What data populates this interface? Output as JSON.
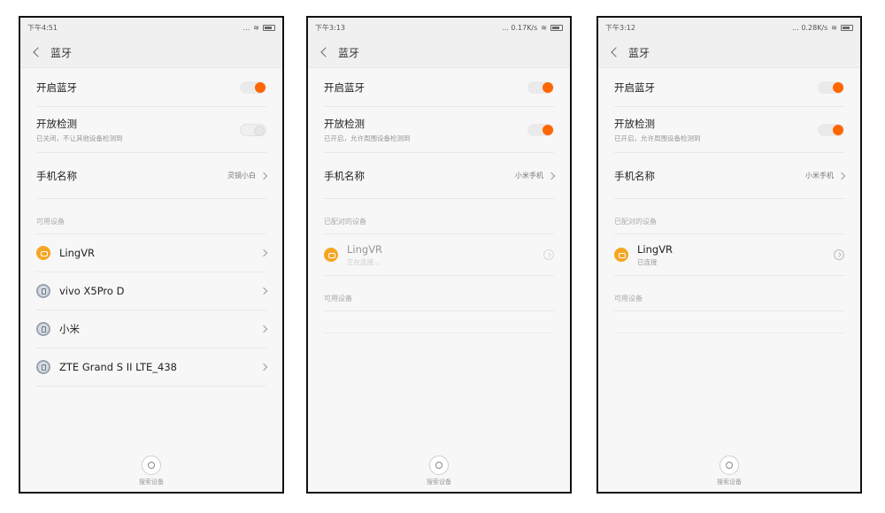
{
  "common": {
    "title": "蓝牙",
    "bt_label": "开启蓝牙",
    "discover_label": "开放检测",
    "name_label": "手机名称",
    "scan_label": "搜索设备"
  },
  "screen1": {
    "time": "下午4:51",
    "net": "...",
    "discover_sub": "已关闭，不让其他设备检测到",
    "phone_name": "灵镜小白",
    "section": "可用设备",
    "devices": [
      {
        "name": "LingVR"
      },
      {
        "name": "vivo X5Pro D"
      },
      {
        "name": "小米"
      },
      {
        "name": "ZTE Grand S II LTE_438"
      }
    ]
  },
  "screen2": {
    "time": "下午3:13",
    "net": "... 0.17K/s",
    "discover_sub": "已开启，允许周围设备检测到",
    "phone_name": "小米手机",
    "paired_section": "已配对的设备",
    "paired_device": {
      "name": "LingVR",
      "status": "正在连接..."
    },
    "available_section": "可用设备"
  },
  "screen3": {
    "time": "下午3:12",
    "net": "... 0.28K/s",
    "discover_sub": "已开启，允许周围设备检测到",
    "phone_name": "小米手机",
    "paired_section": "已配对的设备",
    "paired_device": {
      "name": "LingVR",
      "status": "已连接"
    },
    "available_section": "可用设备"
  },
  "colors": {
    "accent": "#ff6600",
    "device_orange": "#f5a623"
  }
}
